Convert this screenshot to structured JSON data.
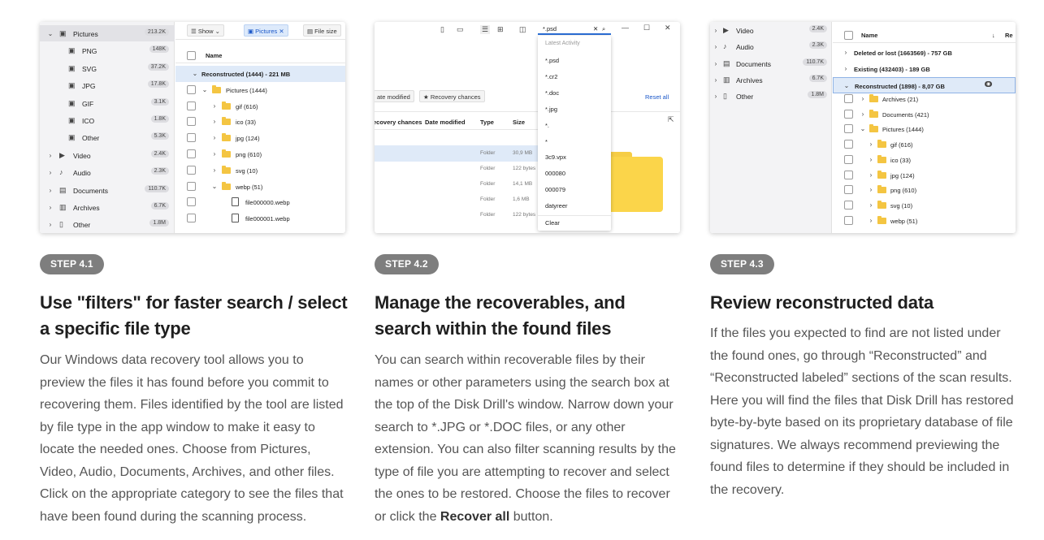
{
  "steps": [
    {
      "badge": "STEP 4.1",
      "title": "Use \"filters\" for faster search / select a specific file type",
      "body": "Our Windows data recovery tool allows you to preview the files it has found before you commit to recovering them. Files identified by the tool are listed by file type in the app window to make it easy to locate the needed ones. Choose from Pictures, Video, Audio, Documents, Archives, and other files. Click on the appropriate category to see the files that have been found during the scanning process."
    },
    {
      "badge": "STEP 4.2",
      "title": "Manage the recoverables, and search within the found files",
      "body_before": "You can search within recoverable files by their names or other parameters using the search box at the top of the Disk Drill's window. Narrow down your search to *.JPG or *.DOC files, or any other extension. You can also filter scanning results by the type of file you are attempting to recover and select the ones to be restored. Choose the files to recover or click the ",
      "body_bold": "Recover all",
      "body_after": " button."
    },
    {
      "badge": "STEP 4.3",
      "title": "Review reconstructed data",
      "body": "If the files you expected to find are not listed under the found ones, go through “Reconstructed” and “Reconstructed labeled” sections of the scan results. Here you will find the files that Disk Drill has restored byte-by-byte based on its proprietary database of file signatures. We always recommend previewing the found files to determine if they should be included in the recovery."
    }
  ],
  "shot1": {
    "sidebar": [
      {
        "label": "Pictures",
        "count": "213.2K",
        "caret": "v",
        "icon": "picture"
      },
      {
        "label": "PNG",
        "count": "148K",
        "icon": "picture"
      },
      {
        "label": "SVG",
        "count": "37.2K",
        "icon": "picture"
      },
      {
        "label": "JPG",
        "count": "17.8K",
        "icon": "picture"
      },
      {
        "label": "GIF",
        "count": "3.1K",
        "icon": "picture"
      },
      {
        "label": "ICO",
        "count": "1.8K",
        "icon": "picture"
      },
      {
        "label": "Other",
        "count": "5.3K",
        "icon": "picture"
      },
      {
        "label": "Video",
        "count": "2.4K",
        "caret": ">",
        "icon": "video"
      },
      {
        "label": "Audio",
        "count": "2.3K",
        "caret": ">",
        "icon": "audio"
      },
      {
        "label": "Documents",
        "count": "110.7K",
        "caret": ">",
        "icon": "document"
      },
      {
        "label": "Archives",
        "count": "6.7K",
        "caret": ">",
        "icon": "archive"
      },
      {
        "label": "Other",
        "count": "1.8M",
        "caret": ">",
        "icon": "other"
      }
    ],
    "toolbar": {
      "show": "Show",
      "filter": "Pictures",
      "file_size": "File size"
    },
    "column_name": "Name",
    "rows": [
      {
        "label": "Reconstructed (1444) - 221 MB",
        "caret": "v"
      },
      {
        "label": "Pictures (1444)",
        "caret": "v",
        "folder": true
      },
      {
        "label": "gif (616)",
        "caret": ">",
        "folder": true
      },
      {
        "label": "ico (33)",
        "caret": ">",
        "folder": true
      },
      {
        "label": "jpg (124)",
        "caret": ">",
        "folder": true
      },
      {
        "label": "png (610)",
        "caret": ">",
        "folder": true
      },
      {
        "label": "svg (10)",
        "caret": ">",
        "folder": true
      },
      {
        "label": "webp (51)",
        "caret": "v",
        "folder": true
      },
      {
        "label": "file000000.webp"
      },
      {
        "label": "file000001.webp"
      }
    ]
  },
  "shot2": {
    "search_value": "*.psd",
    "filter_chips": [
      "ate modified",
      "Recovery chances"
    ],
    "reset_all": "Reset all",
    "columns": [
      "ecovery chances",
      "Date modified",
      "Type",
      "Size"
    ],
    "rows": [
      {
        "type": "Folder",
        "size": "30,9 MB"
      },
      {
        "type": "Folder",
        "size": "122 bytes"
      },
      {
        "type": "Folder",
        "size": "14,1 MB"
      },
      {
        "type": "Folder",
        "size": "1,6 MB"
      },
      {
        "type": "Folder",
        "size": "122 bytes"
      }
    ],
    "dropdown_header": "Latest Activity",
    "recent": [
      "*.psd",
      "*.cr2",
      "*.doc",
      "*.jpg",
      "*.",
      "*",
      "3c9.vpx",
      "000080",
      "000079",
      "datyreer"
    ],
    "clear": "Clear"
  },
  "shot3": {
    "sidebar": [
      {
        "label": "Video",
        "count": "2.4K",
        "icon": "video"
      },
      {
        "label": "Audio",
        "count": "2.3K",
        "icon": "audio"
      },
      {
        "label": "Documents",
        "count": "110.7K",
        "icon": "document"
      },
      {
        "label": "Archives",
        "count": "6.7K",
        "icon": "archive"
      },
      {
        "label": "Other",
        "count": "1.8M",
        "icon": "other"
      }
    ],
    "column_name": "Name",
    "column_next": "Re",
    "groups": [
      {
        "label": "Deleted or lost (1663569) - 757 GB"
      },
      {
        "label": "Existing (432403) - 189 GB"
      },
      {
        "label": "Reconstructed (1898) - 8,07 GB"
      }
    ],
    "rows": [
      {
        "label": "Archives (21)",
        "indent": 1
      },
      {
        "label": "Documents (421)",
        "indent": 1
      },
      {
        "label": "Pictures (1444)",
        "indent": 1,
        "open": true
      },
      {
        "label": "gif (616)",
        "indent": 2
      },
      {
        "label": "ico (33)",
        "indent": 2
      },
      {
        "label": "jpg (124)",
        "indent": 2
      },
      {
        "label": "png (610)",
        "indent": 2
      },
      {
        "label": "svg (10)",
        "indent": 2
      },
      {
        "label": "webp (51)",
        "indent": 2
      }
    ]
  }
}
